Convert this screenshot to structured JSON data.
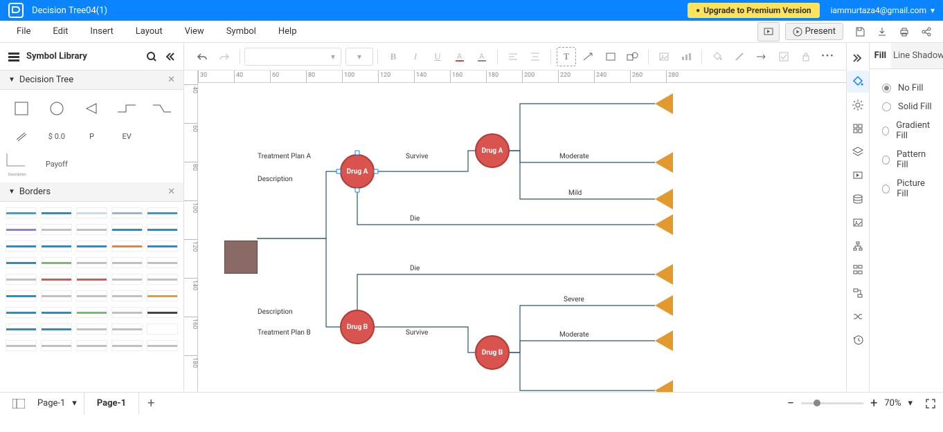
{
  "title": "Decision Tree04(1)",
  "upgrade_label": "Upgrade to Premium Version",
  "account_email": "iammurtaza4@gmail.com",
  "menu": [
    "File",
    "Edit",
    "Insert",
    "Layout",
    "View",
    "Symbol",
    "Help"
  ],
  "present_label": "Present",
  "symbol_library_label": "Symbol Library",
  "sections": {
    "decision_tree": "Decision Tree",
    "borders": "Borders"
  },
  "shapes": {
    "dollar": "$ 0.0",
    "p": "P",
    "ev": "EV",
    "payoff": "Payoff",
    "description": "Description"
  },
  "ruler_h": [
    "30",
    "40",
    "60",
    "80",
    "100",
    "120",
    "140",
    "160",
    "180",
    "200",
    "220",
    "240",
    "260",
    "280"
  ],
  "ruler_v": [
    "40",
    "60",
    "80",
    "100",
    "120",
    "140",
    "160",
    "180"
  ],
  "nodes": {
    "drugA1": "Drug A",
    "drugA2": "Drug A",
    "drugB1": "Drug  B",
    "drugB2": "Drug  B"
  },
  "labels": {
    "treat_a": "Treatment Plan A",
    "desc_a": "Description",
    "survive_a": "Survive",
    "moderate_a": "Moderate",
    "mild_a": "Mild",
    "die_a": "Die",
    "die_b": "Die",
    "desc_b": "Description",
    "treat_b": "Treatment Plan B",
    "survive_b": "Survive",
    "severe_b": "Severe",
    "moderate_b": "Moderate"
  },
  "right_tabs": [
    "Fill",
    "Line",
    "Shadow"
  ],
  "fill_options": [
    "No Fill",
    "Solid Fill",
    "Gradient Fill",
    "Pattern Fill",
    "Picture Fill"
  ],
  "page_select": "Page-1",
  "page_tab": "Page-1",
  "zoom_pct": "70%",
  "border_colors": [
    [
      "#2aa7e0",
      "#1b91d0",
      "#c9dcea",
      "#8fbad6",
      "#1fa0e4"
    ],
    [
      "#9a7ad6",
      "#c0c0c0",
      "#c0c0c0",
      "#1b91d0",
      "#1b91d0"
    ],
    [
      "#1b91d0",
      "#1b91d0",
      "#1b91d0",
      "#f08030",
      "#1b91d0"
    ],
    [
      "#1b91d0",
      "#6fbf73",
      "#c0c0c0",
      "#c0c0c0",
      "#c0c0c0"
    ],
    [
      "#c0c0c0",
      "#d9534f",
      "#d9534f",
      "#c0c0c0",
      "#c0c0c0"
    ],
    [
      "#1b91d0",
      "#c0c0c0",
      "#c0c0c0",
      "#c0c0c0",
      "#e0a030"
    ],
    [
      "#1b91d0",
      "#1b91d0",
      "#6fbf73",
      "#c0c0c0",
      "#444444"
    ],
    [
      "#1b91d0",
      "#1b91d0",
      "#c0c0c0",
      "#c0c0c0",
      "#ffffff"
    ],
    [
      "#c0c0c0",
      "#c0c0c0",
      "#c0c0c0",
      "#c0c0c0",
      "#c0c0c0"
    ]
  ]
}
